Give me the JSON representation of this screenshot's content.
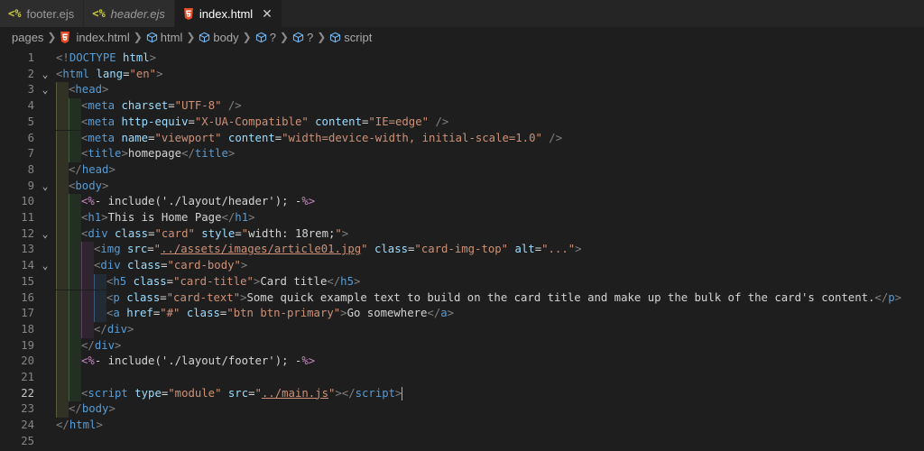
{
  "tabs": [
    {
      "icon": "<%",
      "label": "footer.ejs",
      "italic": false,
      "active": false
    },
    {
      "icon": "<%",
      "label": "header.ejs",
      "italic": true,
      "active": false
    },
    {
      "icon": "html5-icon",
      "label": "index.html",
      "italic": false,
      "active": true,
      "close": "✕"
    }
  ],
  "breadcrumb": [
    "pages",
    "index.html",
    "html",
    "body",
    "?",
    "?",
    "script"
  ],
  "lines": [
    {
      "n": "1",
      "fold": "",
      "depth": 0,
      "segs": [
        [
          "b",
          "<!"
        ],
        [
          "t",
          "DOCTYPE"
        ],
        [
          "e",
          " "
        ],
        [
          "a",
          "html"
        ],
        [
          "b",
          ">"
        ]
      ]
    },
    {
      "n": "2",
      "fold": "⌄",
      "depth": 0,
      "segs": [
        [
          "b",
          "<"
        ],
        [
          "t",
          "html"
        ],
        [
          "e",
          " "
        ],
        [
          "a",
          "lang"
        ],
        [
          "e",
          "="
        ],
        [
          "s",
          "\"en\""
        ],
        [
          "b",
          ">"
        ]
      ]
    },
    {
      "n": "3",
      "fold": "⌄",
      "depth": 1,
      "segs": [
        [
          "b",
          "<"
        ],
        [
          "t",
          "head"
        ],
        [
          "b",
          ">"
        ]
      ]
    },
    {
      "n": "4",
      "fold": "",
      "depth": 2,
      "segs": [
        [
          "b",
          "<"
        ],
        [
          "t",
          "meta"
        ],
        [
          "e",
          " "
        ],
        [
          "a",
          "charset"
        ],
        [
          "e",
          "="
        ],
        [
          "s",
          "\"UTF-8\""
        ],
        [
          "e",
          " "
        ],
        [
          "b",
          "/>"
        ]
      ]
    },
    {
      "n": "5",
      "fold": "",
      "depth": 2,
      "segs": [
        [
          "b",
          "<"
        ],
        [
          "t",
          "meta"
        ],
        [
          "e",
          " "
        ],
        [
          "a",
          "http-equiv"
        ],
        [
          "e",
          "="
        ],
        [
          "s",
          "\"X-UA-Compatible\""
        ],
        [
          "e",
          " "
        ],
        [
          "a",
          "content"
        ],
        [
          "e",
          "="
        ],
        [
          "s",
          "\"IE=edge\""
        ],
        [
          "e",
          " "
        ],
        [
          "b",
          "/>"
        ]
      ]
    },
    {
      "n": "6",
      "fold": "",
      "depth": 2,
      "segs": [
        [
          "b",
          "<"
        ],
        [
          "t",
          "meta"
        ],
        [
          "e",
          " "
        ],
        [
          "a",
          "name"
        ],
        [
          "e",
          "="
        ],
        [
          "s",
          "\"viewport\""
        ],
        [
          "e",
          " "
        ],
        [
          "a",
          "content"
        ],
        [
          "e",
          "="
        ],
        [
          "s",
          "\"width=device-width, initial-scale=1.0\""
        ],
        [
          "e",
          " "
        ],
        [
          "b",
          "/>"
        ]
      ]
    },
    {
      "n": "7",
      "fold": "",
      "depth": 2,
      "segs": [
        [
          "b",
          "<"
        ],
        [
          "t",
          "title"
        ],
        [
          "b",
          ">"
        ],
        [
          "e",
          "homepage"
        ],
        [
          "b",
          "</"
        ],
        [
          "t",
          "title"
        ],
        [
          "b",
          ">"
        ]
      ]
    },
    {
      "n": "8",
      "fold": "",
      "depth": 1,
      "segs": [
        [
          "b",
          "</"
        ],
        [
          "t",
          "head"
        ],
        [
          "b",
          ">"
        ]
      ]
    },
    {
      "n": "9",
      "fold": "⌄",
      "depth": 1,
      "segs": [
        [
          "b",
          "<"
        ],
        [
          "t",
          "body"
        ],
        [
          "b",
          ">"
        ]
      ]
    },
    {
      "n": "10",
      "fold": "",
      "depth": 2,
      "segs": [
        [
          "ej",
          "<%"
        ],
        [
          "e",
          "- include('./layout/header'); -"
        ],
        [
          "ej",
          "%>"
        ]
      ]
    },
    {
      "n": "11",
      "fold": "",
      "depth": 2,
      "segs": [
        [
          "b",
          "<"
        ],
        [
          "t",
          "h1"
        ],
        [
          "b",
          ">"
        ],
        [
          "e",
          "This is Home Page"
        ],
        [
          "b",
          "</"
        ],
        [
          "t",
          "h1"
        ],
        [
          "b",
          ">"
        ]
      ]
    },
    {
      "n": "12",
      "fold": "⌄",
      "depth": 2,
      "segs": [
        [
          "b",
          "<"
        ],
        [
          "t",
          "div"
        ],
        [
          "e",
          " "
        ],
        [
          "a",
          "class"
        ],
        [
          "e",
          "="
        ],
        [
          "s",
          "\"card\""
        ],
        [
          "e",
          " "
        ],
        [
          "a",
          "style"
        ],
        [
          "e",
          "="
        ],
        [
          "s",
          "\""
        ],
        [
          "e",
          "width: 18rem;"
        ],
        [
          "s",
          "\""
        ],
        [
          "b",
          ">"
        ]
      ]
    },
    {
      "n": "13",
      "fold": "",
      "depth": 3,
      "segs": [
        [
          "b",
          "<"
        ],
        [
          "t",
          "img"
        ],
        [
          "e",
          " "
        ],
        [
          "a",
          "src"
        ],
        [
          "e",
          "="
        ],
        [
          "s",
          "\""
        ],
        [
          "su",
          "../assets/images/article01.jpg"
        ],
        [
          "s",
          "\""
        ],
        [
          "e",
          " "
        ],
        [
          "a",
          "class"
        ],
        [
          "e",
          "="
        ],
        [
          "s",
          "\"card-img-top\""
        ],
        [
          "e",
          " "
        ],
        [
          "a",
          "alt"
        ],
        [
          "e",
          "="
        ],
        [
          "s",
          "\"...\""
        ],
        [
          "b",
          ">"
        ]
      ]
    },
    {
      "n": "14",
      "fold": "⌄",
      "depth": 3,
      "segs": [
        [
          "b",
          "<"
        ],
        [
          "t",
          "div"
        ],
        [
          "e",
          " "
        ],
        [
          "a",
          "class"
        ],
        [
          "e",
          "="
        ],
        [
          "s",
          "\"card-body\""
        ],
        [
          "b",
          ">"
        ]
      ]
    },
    {
      "n": "15",
      "fold": "",
      "depth": 4,
      "segs": [
        [
          "b",
          "<"
        ],
        [
          "t",
          "h5"
        ],
        [
          "e",
          " "
        ],
        [
          "a",
          "class"
        ],
        [
          "e",
          "="
        ],
        [
          "s",
          "\"card-title\""
        ],
        [
          "b",
          ">"
        ],
        [
          "e",
          "Card title"
        ],
        [
          "b",
          "</"
        ],
        [
          "t",
          "h5"
        ],
        [
          "b",
          ">"
        ]
      ]
    },
    {
      "n": "16",
      "fold": "",
      "depth": 4,
      "segs": [
        [
          "b",
          "<"
        ],
        [
          "t",
          "p"
        ],
        [
          "e",
          " "
        ],
        [
          "a",
          "class"
        ],
        [
          "e",
          "="
        ],
        [
          "s",
          "\"card-text\""
        ],
        [
          "b",
          ">"
        ],
        [
          "e",
          "Some quick example text to build on the card title and make up the bulk of the card's content."
        ],
        [
          "b",
          "</"
        ],
        [
          "t",
          "p"
        ],
        [
          "b",
          ">"
        ]
      ]
    },
    {
      "n": "17",
      "fold": "",
      "depth": 4,
      "segs": [
        [
          "b",
          "<"
        ],
        [
          "t",
          "a"
        ],
        [
          "e",
          " "
        ],
        [
          "a",
          "href"
        ],
        [
          "e",
          "="
        ],
        [
          "s",
          "\"#\""
        ],
        [
          "e",
          " "
        ],
        [
          "a",
          "class"
        ],
        [
          "e",
          "="
        ],
        [
          "s",
          "\"btn btn-primary\""
        ],
        [
          "b",
          ">"
        ],
        [
          "e",
          "Go somewhere"
        ],
        [
          "b",
          "</"
        ],
        [
          "t",
          "a"
        ],
        [
          "b",
          ">"
        ]
      ]
    },
    {
      "n": "18",
      "fold": "",
      "depth": 3,
      "segs": [
        [
          "b",
          "</"
        ],
        [
          "t",
          "div"
        ],
        [
          "b",
          ">"
        ]
      ]
    },
    {
      "n": "19",
      "fold": "",
      "depth": 2,
      "segs": [
        [
          "b",
          "</"
        ],
        [
          "t",
          "div"
        ],
        [
          "b",
          ">"
        ]
      ]
    },
    {
      "n": "20",
      "fold": "",
      "depth": 2,
      "segs": [
        [
          "ej",
          "<%"
        ],
        [
          "e",
          "- include('./layout/footer'); -"
        ],
        [
          "ej",
          "%>"
        ]
      ]
    },
    {
      "n": "21",
      "fold": "",
      "depth": 2,
      "segs": []
    },
    {
      "n": "22",
      "fold": "",
      "depth": 2,
      "current": true,
      "segs": [
        [
          "b",
          "<"
        ],
        [
          "t",
          "script"
        ],
        [
          "e",
          " "
        ],
        [
          "a",
          "type"
        ],
        [
          "e",
          "="
        ],
        [
          "s",
          "\"module\""
        ],
        [
          "e",
          " "
        ],
        [
          "a",
          "src"
        ],
        [
          "e",
          "="
        ],
        [
          "s",
          "\""
        ],
        [
          "su",
          "../main.js"
        ],
        [
          "s",
          "\""
        ],
        [
          "b",
          "></"
        ],
        [
          "t",
          "script"
        ],
        [
          "b",
          ">"
        ]
      ]
    },
    {
      "n": "23",
      "fold": "",
      "depth": 1,
      "segs": [
        [
          "b",
          "</"
        ],
        [
          "t",
          "body"
        ],
        [
          "b",
          ">"
        ]
      ]
    },
    {
      "n": "24",
      "fold": "",
      "depth": 0,
      "segs": [
        [
          "b",
          "</"
        ],
        [
          "t",
          "html"
        ],
        [
          "b",
          ">"
        ]
      ]
    },
    {
      "n": "25",
      "fold": "",
      "depth": 0,
      "segs": []
    }
  ]
}
